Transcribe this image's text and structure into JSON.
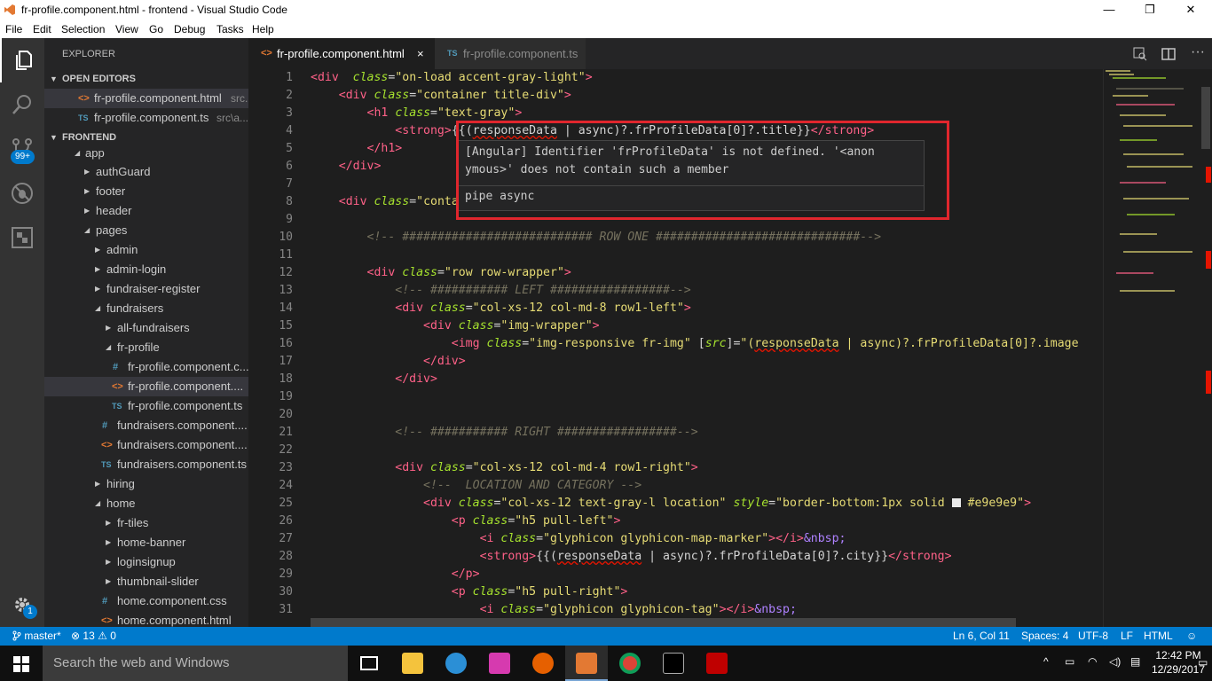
{
  "window": {
    "title": "fr-profile.component.html - frontend - Visual Studio Code",
    "minimize_glyph": "—",
    "maximize_glyph": "❐",
    "close_glyph": "✕"
  },
  "menu": [
    "File",
    "Edit",
    "Selection",
    "View",
    "Go",
    "Debug",
    "Tasks",
    "Help"
  ],
  "activity": {
    "scm_badge": "99+",
    "settings_badge": "1"
  },
  "sidebar": {
    "title": "EXPLORER",
    "open_editors_label": "OPEN EDITORS",
    "frontend_label": "FRONTEND",
    "open_editors": [
      {
        "name": "fr-profile.component.html",
        "hint": "src..."
      },
      {
        "name": "fr-profile.component.ts",
        "hint": "src\\a..."
      }
    ],
    "tree": [
      {
        "name": "app"
      },
      {
        "name": "authGuard"
      },
      {
        "name": "footer"
      },
      {
        "name": "header"
      },
      {
        "name": "pages"
      },
      {
        "name": "admin"
      },
      {
        "name": "admin-login"
      },
      {
        "name": "fundraiser-register"
      },
      {
        "name": "fundraisers"
      },
      {
        "name": "all-fundraisers"
      },
      {
        "name": "fr-profile"
      },
      {
        "name": "fr-profile.component.c..."
      },
      {
        "name": "fr-profile.component...."
      },
      {
        "name": "fr-profile.component.ts"
      },
      {
        "name": "fundraisers.component...."
      },
      {
        "name": "fundraisers.component...."
      },
      {
        "name": "fundraisers.component.ts"
      },
      {
        "name": "hiring"
      },
      {
        "name": "home"
      },
      {
        "name": "fr-tiles"
      },
      {
        "name": "home-banner"
      },
      {
        "name": "loginsignup"
      },
      {
        "name": "thumbnail-slider"
      },
      {
        "name": "home.component.css"
      },
      {
        "name": "home.component.html"
      }
    ]
  },
  "tabs": [
    {
      "label": "fr-profile.component.html",
      "close": "×"
    },
    {
      "label": "fr-profile.component.ts"
    }
  ],
  "editor": {
    "line_numbers": [
      "1",
      "2",
      "3",
      "4",
      "5",
      "6",
      "7",
      "8",
      "9",
      "10",
      "11",
      "12",
      "13",
      "14",
      "15",
      "16",
      "17",
      "18",
      "19",
      "20",
      "21",
      "22",
      "23",
      "24",
      "25",
      "26",
      "27",
      "28",
      "29",
      "30",
      "31"
    ],
    "hover": {
      "line1": "[Angular] Identifier 'frProfileData' is not defined. '<anon",
      "line2": "ymous>' does not contain such a member",
      "line3": "pipe async"
    }
  },
  "status": {
    "branch": "master*",
    "errors": "13",
    "warnings": "0",
    "position": "Ln 6, Col 11",
    "spaces": "Spaces: 4",
    "encoding": "UTF-8",
    "eol": "LF",
    "language": "HTML"
  },
  "taskbar": {
    "search_placeholder": "Search the web and Windows",
    "time": "12:42 PM",
    "date": "12/29/2017"
  },
  "colors": {
    "accent": "#007acc",
    "error_highlight": "#e0262d"
  }
}
